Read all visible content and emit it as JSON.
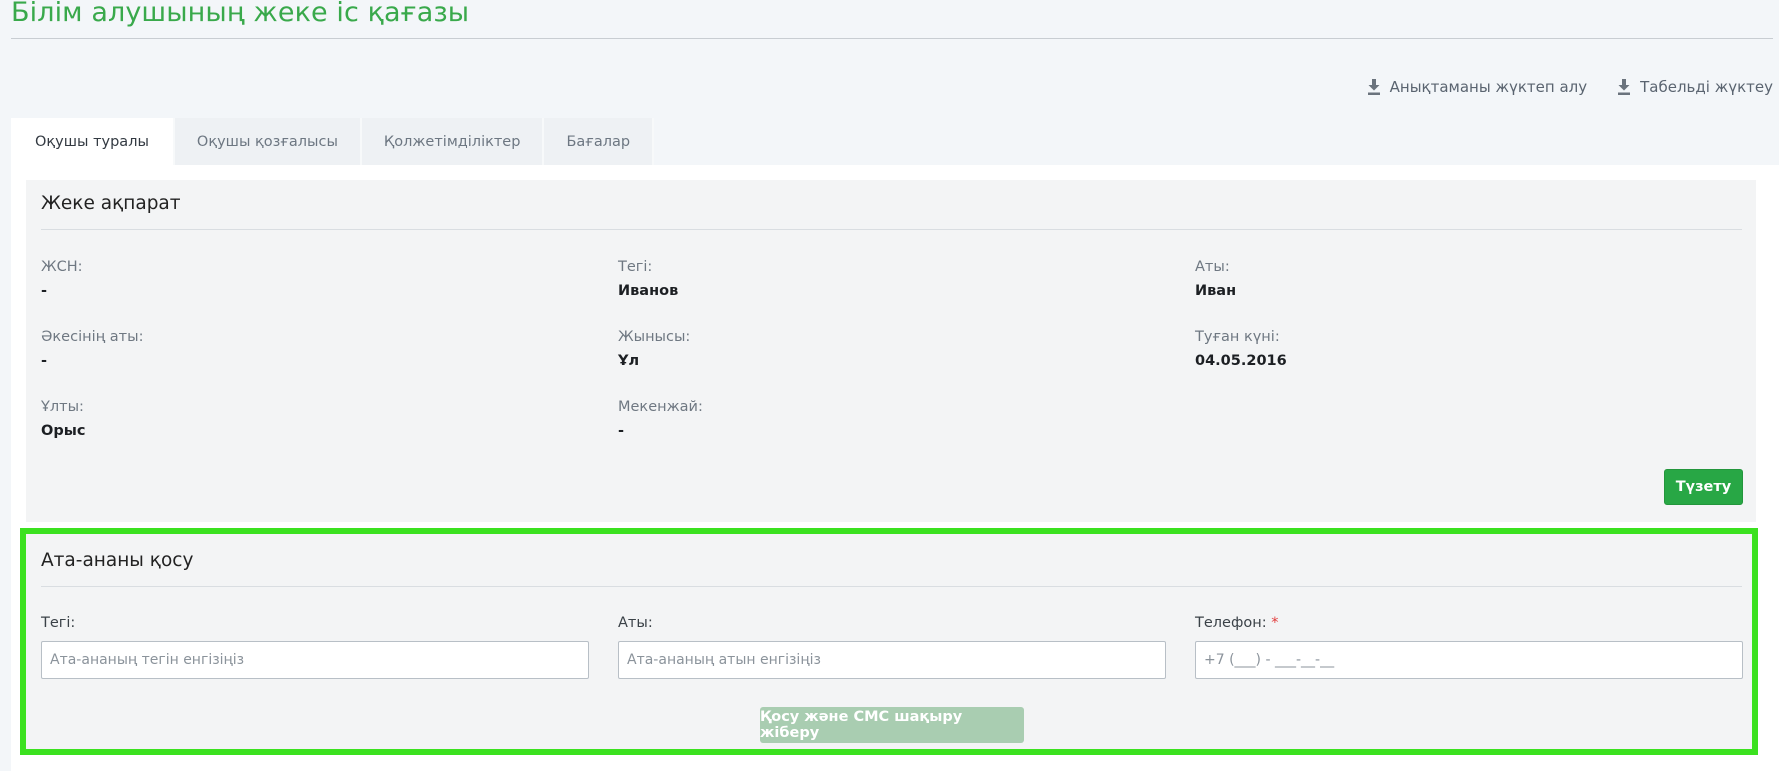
{
  "page": {
    "title": "Білім алушының жеке іс қағазы"
  },
  "actions": [
    {
      "label": "Анықтаманы жүктеп алу",
      "icon": "download-icon"
    },
    {
      "label": "Табельді жүктеу",
      "icon": "download-icon"
    }
  ],
  "tabs": [
    {
      "label": "Оқушы туралы",
      "active": true
    },
    {
      "label": "Оқушы қозғалысы",
      "active": false
    },
    {
      "label": "Қолжетімділіктер",
      "active": false
    },
    {
      "label": "Бағалар",
      "active": false
    }
  ],
  "personal": {
    "title": "Жеке ақпарат",
    "fields": [
      {
        "label": "ЖСН:",
        "value": "-"
      },
      {
        "label": "Тегі:",
        "value": "Иванов"
      },
      {
        "label": "Аты:",
        "value": "Иван"
      },
      {
        "label": "Әкесінің аты:",
        "value": "-"
      },
      {
        "label": "Жынысы:",
        "value": "Ұл"
      },
      {
        "label": "Туған күні:",
        "value": "04.05.2016"
      },
      {
        "label": "Ұлты:",
        "value": "Орыс"
      },
      {
        "label": "Мекенжай:",
        "value": "-"
      }
    ],
    "edit_button": "Түзету"
  },
  "parent": {
    "title": "Ата-ананы қосу",
    "surname_label": "Тегі:",
    "surname_placeholder": "Ата-ананың тегін енгізіңіз",
    "name_label": "Аты:",
    "name_placeholder": "Ата-ананың атын енгізіңіз",
    "phone_label": "Телефон:",
    "phone_required": "*",
    "phone_placeholder": "+7 (___) - ___-__-__",
    "submit_button": "Қосу және СМС шақыру жіберу"
  },
  "colors": {
    "accent": "#39a94b",
    "button": "#28a745",
    "highlight": "#3be11f"
  }
}
